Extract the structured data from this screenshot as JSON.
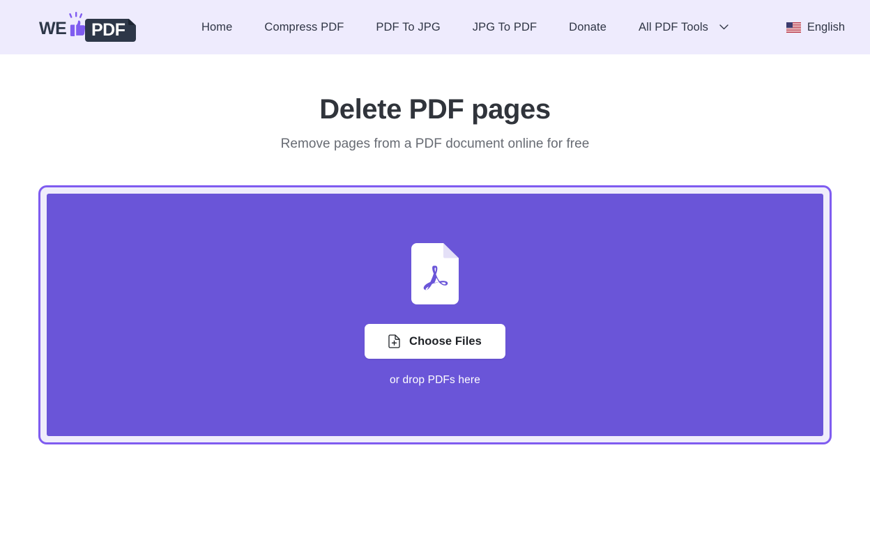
{
  "header": {
    "logo": {
      "text_left": "WE",
      "text_right": "PDF",
      "icon": "thumbs-up-icon",
      "alt": "WePDF"
    },
    "nav_items": [
      {
        "label": "Home",
        "name": "nav-item-home",
        "dropdown": false
      },
      {
        "label": "Compress PDF",
        "name": "nav-item-compress-pdf",
        "dropdown": false
      },
      {
        "label": "PDF To JPG",
        "name": "nav-item-pdf-to-jpg",
        "dropdown": false
      },
      {
        "label": "JPG To PDF",
        "name": "nav-item-jpg-to-pdf",
        "dropdown": false
      },
      {
        "label": "Donate",
        "name": "nav-item-donate",
        "dropdown": false
      },
      {
        "label": "All PDF Tools",
        "name": "nav-item-all-pdf-tools",
        "dropdown": true
      }
    ],
    "language": {
      "label": "English",
      "flag": "us-flag-icon"
    }
  },
  "main": {
    "title": "Delete PDF pages",
    "subtitle": "Remove pages from a PDF document online for free"
  },
  "dropzone": {
    "file_icon": "pdf-file-icon",
    "button_label": "Choose Files",
    "button_icon": "file-plus-icon",
    "hint": "or drop PDFs here"
  },
  "colors": {
    "header_bg": "#eeebfd",
    "accent_purple": "#7f5cf0",
    "dropzone_fill": "#6a55d8",
    "dropzone_gap": "#efedfb",
    "logo_dark": "#2d3748",
    "title": "#30343b",
    "subtitle": "#676b73"
  }
}
